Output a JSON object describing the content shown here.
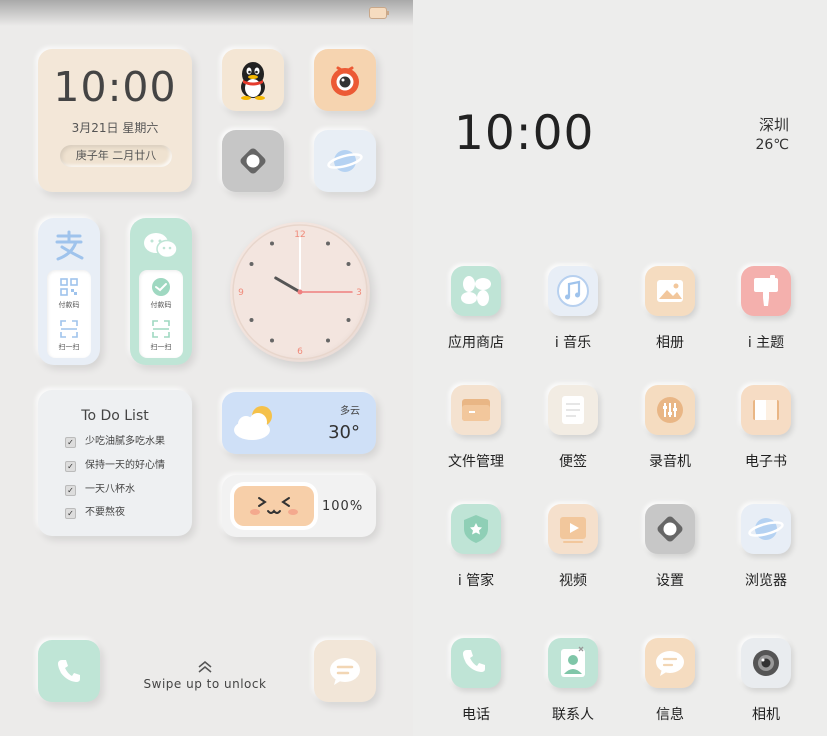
{
  "lock": {
    "clock_time": "10:00",
    "date": "3月21日  星期六",
    "lunar": "庚子年  二月廿八",
    "alipay": {
      "pay_label": "付款码",
      "scan_label": "扫一扫"
    },
    "wechat": {
      "pay_label": "付款码",
      "scan_label": "扫一扫"
    },
    "analog_clock": {
      "hour_numerals": [
        "12",
        "3",
        "6",
        "9"
      ],
      "hours": 10,
      "minutes": 0,
      "seconds": 15
    },
    "todo": {
      "title": "To Do List",
      "items": [
        "少吃油腻多吃水果",
        "保持一天的好心情",
        "一天八杯水",
        "不要熬夜"
      ]
    },
    "weather": {
      "condition": "多云",
      "temperature": "30°"
    },
    "battery_widget": {
      "percent": "100%"
    },
    "unlock_hint": "Swipe up to unlock",
    "apps": [
      "qq-icon",
      "camera-red-icon",
      "settings-icon",
      "browser-icon"
    ]
  },
  "home": {
    "time": "10:00",
    "city": "深圳",
    "temperature": "26℃",
    "apps": [
      {
        "label": "应用商店",
        "icon": "app-store-icon",
        "color": "#bfe4d6"
      },
      {
        "label": "i 音乐",
        "icon": "music-icon",
        "color": "#e8eef6"
      },
      {
        "label": "相册",
        "icon": "gallery-icon",
        "color": "#f5dcc0"
      },
      {
        "label": "i 主题",
        "icon": "theme-icon",
        "color": "#f4b0ad"
      },
      {
        "label": "文件管理",
        "icon": "file-manager-icon",
        "color": "#f4e2d0"
      },
      {
        "label": "便签",
        "icon": "notes-icon",
        "color": "#f2ece3"
      },
      {
        "label": "录音机",
        "icon": "recorder-icon",
        "color": "#f5dcc0"
      },
      {
        "label": "电子书",
        "icon": "ebook-icon",
        "color": "#f6dcc4"
      },
      {
        "label": "i 管家",
        "icon": "security-icon",
        "color": "#bfe4d6"
      },
      {
        "label": "视频",
        "icon": "video-icon",
        "color": "#f5e0cc"
      },
      {
        "label": "设置",
        "icon": "settings-icon",
        "color": "#c7c7c7"
      },
      {
        "label": "浏览器",
        "icon": "browser-icon",
        "color": "#e8eef6"
      },
      {
        "label": "电话",
        "icon": "phone-icon",
        "color": "#bfe4d6"
      },
      {
        "label": "联系人",
        "icon": "contacts-icon",
        "color": "#bfe4d6"
      },
      {
        "label": "信息",
        "icon": "messages-icon",
        "color": "#f5dcc0"
      },
      {
        "label": "相机",
        "icon": "camera-icon",
        "color": "#e9ecef"
      }
    ]
  }
}
